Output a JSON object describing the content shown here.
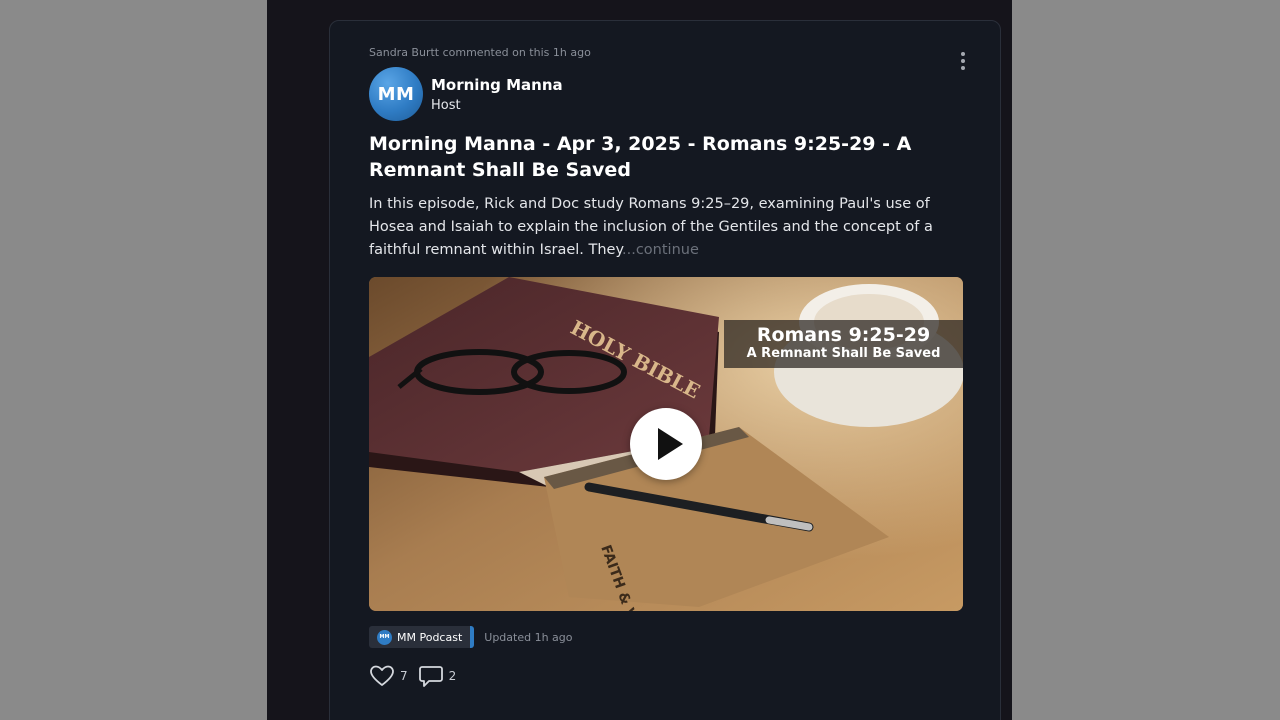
{
  "activity": {
    "text": "Sandra Burtt commented on this 1h ago"
  },
  "author": {
    "initials": "MM",
    "name": "Morning Manna",
    "role": "Host"
  },
  "post": {
    "title": "Morning Manna - Apr 3, 2025 - Romans 9:25-29 - A Remnant Shall Be Saved",
    "excerpt": "In this episode, Rick and Doc study Romans 9:25–29, examining Paul's use of Hosea and Isaiah to explain the inclusion of the Gentiles and the concept of a faithful remnant within Israel. They",
    "continue_label": "...continue"
  },
  "media": {
    "overlay_title": "Romans 9:25-29",
    "overlay_subtitle": "A Remnant Shall Be Saved",
    "bible_text": "HOLY BIBLE",
    "notebook_text": "FAITH & VALUES"
  },
  "meta": {
    "channel_icon_text": "MM",
    "channel_label": "MM Podcast",
    "updated_text": "Updated 1h ago"
  },
  "reactions": {
    "likes": "7",
    "comments": "2"
  },
  "colors": {
    "accent": "#2f7cc4",
    "card_bg": "#141821",
    "page_bg": "#8a8a8a"
  }
}
